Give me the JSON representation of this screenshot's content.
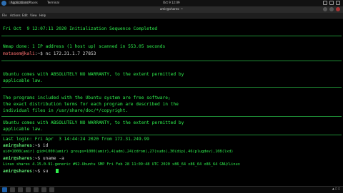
{
  "top_panel": {
    "applications_label": "Applications",
    "places_label": "Places",
    "terminal_app_label": "Terminal",
    "clock": "Oct 9  12:09"
  },
  "window": {
    "title": "amir@shares: ~",
    "menu": [
      "File",
      "Actions",
      "Edit",
      "View",
      "Help"
    ]
  },
  "terminal": {
    "line_header": "Fri Oct  9 12:07:11 2020 Initialization Sequence Completed",
    "nmap_line": "Nmap done: 1 IP address (1 host up) scanned in 553.05 seconds",
    "prompt1_user": "motasem@kali",
    "prompt1_path": ":~$ ",
    "prompt1_cmd": "nc 172.31.1.7 27853",
    "warranty1": "Ubuntu comes with ABSOLUTELY NO WARRANTY, to the extent permitted by",
    "warranty1b": "applicable law.",
    "free1": "The programs included with the Ubuntu system are free software;",
    "free2": "the exact distribution terms for each program are described in the",
    "free3": "individual files in /usr/share/doc/*/copyright.",
    "warranty2": "Ubuntu comes with ABSOLUTELY NO WARRANTY, to the extent permitted by",
    "warranty2b": "applicable law.",
    "last_login": "Last login: Fri Apr  3 14:44:24 2020 from 172.31.249.99",
    "prompt2_user": "amir@shares",
    "prompt2_path": ":~$ ",
    "prompt2_cmd": "id",
    "id_output": "uid=1000(amir) gid=1000(amir) groups=1000(amir),4(adm),24(cdrom),27(sudo),30(dip),46(plugdev),108(lxd)",
    "prompt3_user": "amir@shares",
    "prompt3_path": ":~$ ",
    "prompt3_cmd": "uname -a",
    "uname_output": "Linux shares 4.15.0-91-generic #92-Ubuntu SMP Fri Feb 28 11:09:48 UTC 2020 x86_64 x86_64 x86_64 GNU/Linux",
    "prompt4_user": "amir@shares",
    "prompt4_path": ":~$ ",
    "prompt4_cmd": "su"
  },
  "colors": {
    "terminal_text": "#2ef04d",
    "terminal_bg": "#000000"
  }
}
